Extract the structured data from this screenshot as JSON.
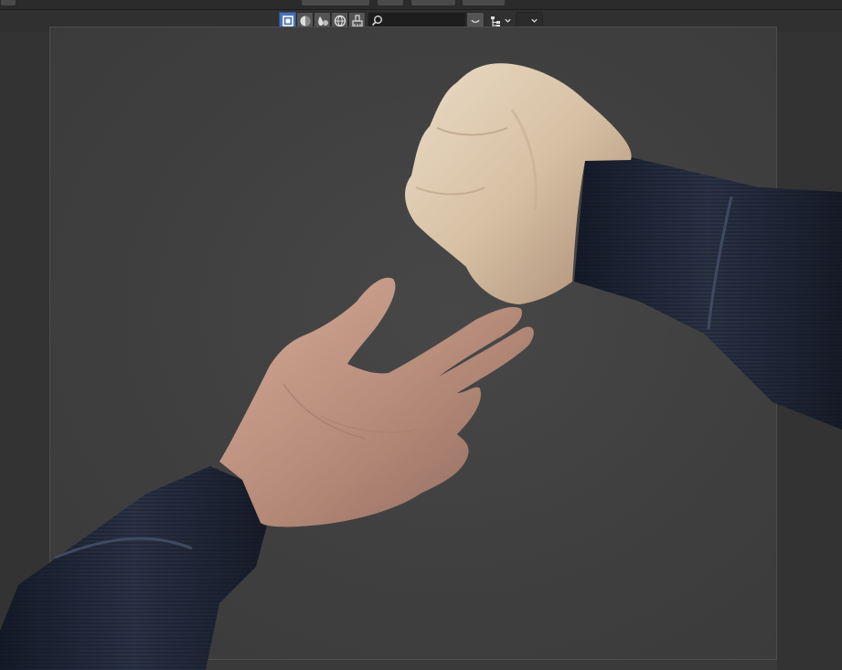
{
  "header": {
    "select_mode_icons": [
      "select-box-icon",
      "shading-solid-icon",
      "shading-material-icon",
      "shading-rendered-icon",
      "brush-icon"
    ],
    "search": {
      "value": "",
      "placeholder": ""
    },
    "filter_icon": "filter-icon",
    "hierarchy_icon": "outliner-hierarchy-icon",
    "dropdown_icon": "chevron-down-icon"
  },
  "colors": {
    "active_tool": "#4772b3",
    "header_bg": "#303030",
    "viewport_bg": "#3a3a3a",
    "skin": "#c49b86",
    "sleeve": "#1c2232"
  }
}
